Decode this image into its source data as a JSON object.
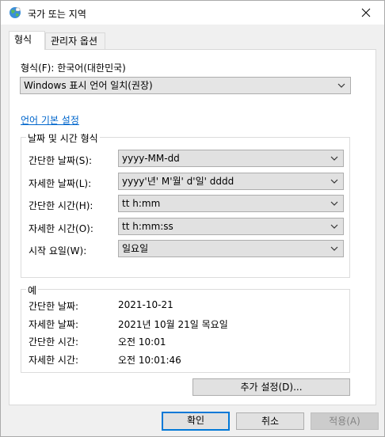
{
  "window": {
    "title": "국가 또는 지역",
    "icon": "globe-icon",
    "close_icon": "close-icon"
  },
  "tabs": [
    {
      "label": "형식",
      "active": true
    },
    {
      "label": "관리자 옵션",
      "active": false
    }
  ],
  "format": {
    "label": "형식(F): 한국어(대한민국)",
    "selected": "Windows 표시 언어 일치(권장)",
    "language_settings_link": "언어 기본 설정"
  },
  "datetime_formats": {
    "group_title": "날짜 및 시간 형식",
    "rows": [
      {
        "label": "간단한 날짜(S):",
        "value": "yyyy-MM-dd"
      },
      {
        "label": "자세한 날짜(L):",
        "value": "yyyy'년' M'월' d'일' dddd"
      },
      {
        "label": "간단한 시간(H):",
        "value": "tt h:mm"
      },
      {
        "label": "자세한 시간(O):",
        "value": "tt h:mm:ss"
      },
      {
        "label": "시작 요일(W):",
        "value": "일요일"
      }
    ]
  },
  "examples": {
    "group_title": "예",
    "rows": [
      {
        "label": "간단한 날짜:",
        "value": "2021-10-21"
      },
      {
        "label": "자세한 날짜:",
        "value": "2021년 10월 21일 목요일"
      },
      {
        "label": "간단한 시간:",
        "value": "오전 10:01"
      },
      {
        "label": "자세한 시간:",
        "value": "오전 10:01:46"
      }
    ]
  },
  "buttons": {
    "additional_settings": "추가 설정(D)...",
    "ok": "확인",
    "cancel": "취소",
    "apply": "적용(A)"
  },
  "colors": {
    "link": "#0066cc",
    "focus_border": "#0078d7"
  }
}
